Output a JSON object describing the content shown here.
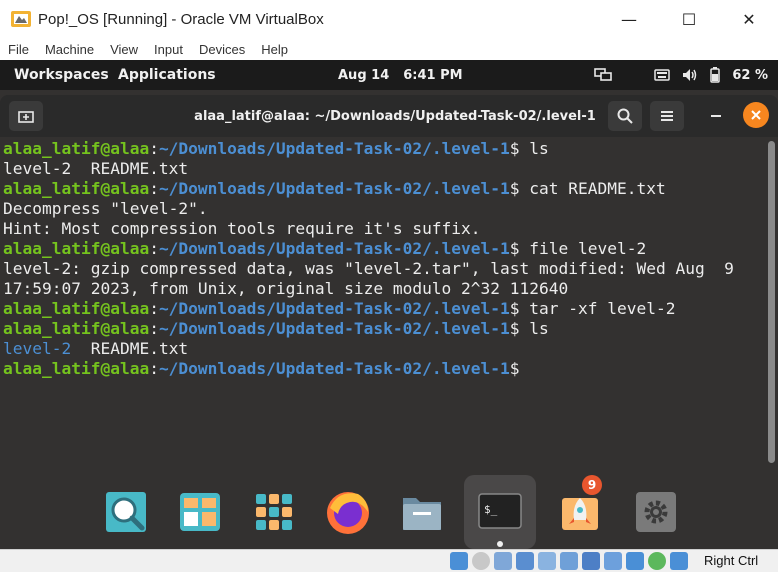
{
  "window": {
    "title": "Pop!_OS [Running] - Oracle VM VirtualBox",
    "minimize_glyph": "—",
    "maximize_glyph": "☐",
    "close_glyph": "✕"
  },
  "menubar": [
    "File",
    "Machine",
    "View",
    "Input",
    "Devices",
    "Help"
  ],
  "top_panel": {
    "workspaces": "Workspaces",
    "applications": "Applications",
    "date": "Aug 14",
    "time": "6:41 PM",
    "battery": "62 %"
  },
  "terminal": {
    "title": "alaa_latif@alaa: ~/Downloads/Updated-Task-02/.level-1",
    "user": "alaa_latif@alaa",
    "sep": ":",
    "path": "~/Downloads/Updated-Task-02/.level-1",
    "dollar": "$",
    "lines": [
      {
        "type": "prompt",
        "cmd": " ls"
      },
      {
        "type": "out",
        "text": "level-2  README.txt"
      },
      {
        "type": "prompt",
        "cmd": " cat README.txt"
      },
      {
        "type": "out",
        "text": "Decompress \"level-2\"."
      },
      {
        "type": "out",
        "text": "Hint: Most compression tools require it's suffix."
      },
      {
        "type": "prompt",
        "cmd": " file level-2"
      },
      {
        "type": "out",
        "text": "level-2: gzip compressed data, was \"level-2.tar\", last modified: Wed Aug  9"
      },
      {
        "type": "out",
        "text": "17:59:07 2023, from Unix, original size modulo 2^32 112640"
      },
      {
        "type": "prompt",
        "cmd": " tar -xf level-2"
      },
      {
        "type": "prompt",
        "cmd": " ls"
      },
      {
        "type": "ls",
        "dir": "level-2",
        "rest": "  README.txt"
      },
      {
        "type": "prompt",
        "cmd": ""
      }
    ]
  },
  "dock": {
    "items": [
      "system-search",
      "pop-shop",
      "app-grid",
      "firefox",
      "files",
      "terminal",
      "software-updates",
      "settings"
    ],
    "terminal_glyph": "$_",
    "updates_badge": "9"
  },
  "statusbar": {
    "host_key": "Right Ctrl"
  },
  "colors": {
    "prompt_user": "#75c31e",
    "prompt_path": "#4c8fd3",
    "terminal_bg": "#333130",
    "close_accent": "#f6861f"
  }
}
